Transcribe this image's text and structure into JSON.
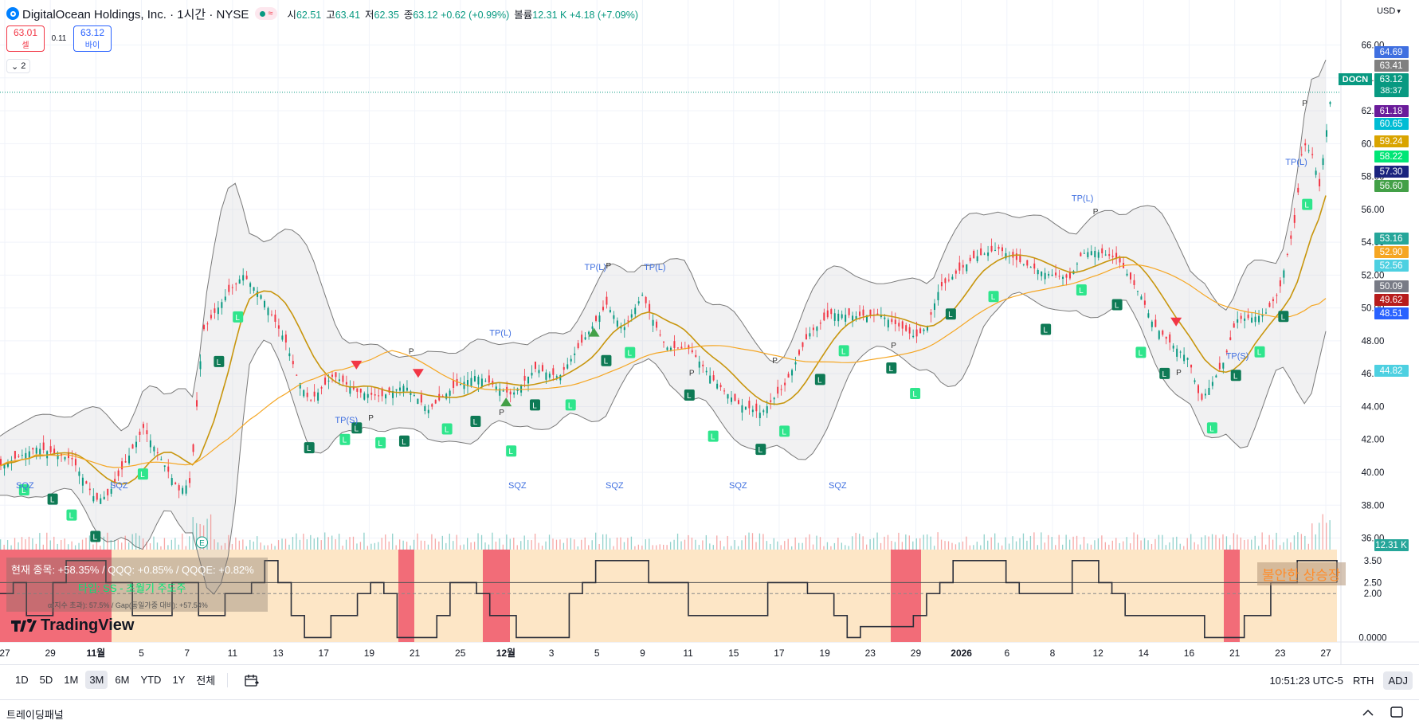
{
  "header": {
    "symbol_title": "DigitalOcean Holdings, Inc. · 1시간 · NYSE",
    "status_icon": "≈",
    "ohlc": [
      {
        "k": "시",
        "v": "62.51"
      },
      {
        "k": "고",
        "v": "63.41"
      },
      {
        "k": "저",
        "v": "62.35"
      },
      {
        "k": "종",
        "v": "63.12 +0.62 (+0.99%)"
      }
    ],
    "volume_label": "볼륨",
    "volume_value": "12.31 K +4.18 (+7.09%)"
  },
  "trade": {
    "sell_price": "63.01",
    "sell_label": "셀",
    "spread": "0.11",
    "buy_price": "63.12",
    "buy_label": "바이"
  },
  "collapse": {
    "icon": "chevron-down-icon",
    "count": "2"
  },
  "currency": {
    "label": "USD"
  },
  "chart_data": {
    "type": "candlestick",
    "symbol": "DOCN",
    "price_axis": {
      "ticks": [
        "66.00",
        "64.00",
        "62.00",
        "60.00",
        "58.00",
        "56.00",
        "54.00",
        "52.00",
        "50.00",
        "48.00",
        "46.00",
        "44.00",
        "42.00",
        "40.00",
        "38.00",
        "36.00"
      ],
      "tick_values": [
        66,
        64,
        62,
        60,
        58,
        56,
        54,
        52,
        50,
        48,
        46,
        44,
        42,
        40,
        38,
        36
      ],
      "range": [
        35.3,
        66.8
      ]
    },
    "time_axis": {
      "labels": [
        "27",
        "29",
        "11월",
        "5",
        "7",
        "11",
        "13",
        "17",
        "19",
        "21",
        "25",
        "12월",
        "3",
        "5",
        "9",
        "11",
        "15",
        "17",
        "19",
        "23",
        "29",
        "2026",
        "6",
        "8",
        "12",
        "14",
        "16",
        "21",
        "23",
        "27"
      ],
      "bold": [
        "11월",
        "12월",
        "2026"
      ]
    },
    "price_path": [
      [
        0,
        40.4
      ],
      [
        15,
        41.5
      ],
      [
        30,
        40.8
      ],
      [
        40,
        38.3
      ],
      [
        45,
        38.6
      ],
      [
        50,
        39.9
      ],
      [
        60,
        42.7
      ],
      [
        75,
        38.9
      ],
      [
        80,
        39.4
      ],
      [
        85,
        48.6
      ],
      [
        95,
        50.8
      ],
      [
        102,
        52.0
      ],
      [
        110,
        50.7
      ],
      [
        120,
        47.9
      ],
      [
        125,
        45.7
      ],
      [
        130,
        44.3
      ],
      [
        140,
        45.9
      ],
      [
        150,
        44.9
      ],
      [
        160,
        44.6
      ],
      [
        170,
        45.3
      ],
      [
        180,
        43.8
      ],
      [
        190,
        45.1
      ],
      [
        200,
        45.9
      ],
      [
        215,
        44.7
      ],
      [
        225,
        46.3
      ],
      [
        235,
        45.8
      ],
      [
        245,
        48.0
      ],
      [
        255,
        50.2
      ],
      [
        262,
        48.7
      ],
      [
        270,
        50.8
      ],
      [
        275,
        49.1
      ],
      [
        280,
        47.6
      ],
      [
        290,
        47.5
      ],
      [
        300,
        45.6
      ],
      [
        310,
        44.2
      ],
      [
        320,
        43.6
      ],
      [
        330,
        45.3
      ],
      [
        340,
        48.4
      ],
      [
        350,
        49.7
      ],
      [
        360,
        49.5
      ],
      [
        370,
        49.6
      ],
      [
        380,
        48.7
      ],
      [
        385,
        48.2
      ],
      [
        390,
        48.9
      ],
      [
        395,
        51.2
      ],
      [
        410,
        53.1
      ],
      [
        420,
        53.6
      ],
      [
        430,
        52.7
      ],
      [
        440,
        52.1
      ],
      [
        450,
        51.8
      ],
      [
        455,
        53.3
      ],
      [
        460,
        53.5
      ],
      [
        470,
        53.0
      ],
      [
        480,
        50.7
      ],
      [
        485,
        49.0
      ],
      [
        492,
        47.9
      ],
      [
        500,
        46.9
      ],
      [
        505,
        44.3
      ],
      [
        510,
        45.5
      ],
      [
        515,
        46.8
      ],
      [
        520,
        49.3
      ],
      [
        526,
        49.4
      ],
      [
        532,
        49.6
      ],
      [
        538,
        51.0
      ],
      [
        545,
        55.5
      ],
      [
        548,
        60.1
      ],
      [
        552,
        59.3
      ],
      [
        555,
        57.4
      ],
      [
        560,
        63.1
      ]
    ],
    "price_x_range": [
      0,
      560
    ],
    "price_labels": [
      {
        "value": "64.69",
        "color": "#3f6fe0"
      },
      {
        "value": "63.41",
        "color": "#808080"
      },
      {
        "value": "63.12",
        "sub": "38:37",
        "color": "#089981",
        "tag": "DOCN"
      },
      {
        "value": "61.18",
        "color": "#6a1b9a"
      },
      {
        "value": "60.65",
        "color": "#00bcd4"
      },
      {
        "value": "59.24",
        "color": "#d9a400"
      },
      {
        "value": "58.22",
        "color": "#00e676"
      },
      {
        "value": "57.30",
        "color": "#1a237e"
      },
      {
        "value": "56.60",
        "color": "#43a047"
      },
      {
        "value": "53.16",
        "color": "#26a69a"
      },
      {
        "value": "52.90",
        "color": "#f5a623"
      },
      {
        "value": "52.56",
        "color": "#4dd0e1"
      },
      {
        "value": "50.09",
        "color": "#787b86"
      },
      {
        "value": "49.62",
        "color": "#b71c1c"
      },
      {
        "value": "48.51",
        "color": "#2962ff"
      },
      {
        "value": "44.82",
        "color": "#4dd0e1"
      },
      {
        "value": "12.31 K",
        "color": "#26a69a"
      }
    ],
    "annotations": {
      "tp_labels": [
        "TP(L)",
        "TP(L)",
        "TP(L)",
        "TP(L)",
        "TP(L)",
        "TP(S)",
        "TP(S)"
      ],
      "sqz_labels": [
        "SQZ",
        "SQZ",
        "SQZ",
        "SQZ",
        "SQZ",
        "SQZ"
      ],
      "p_labels": [
        "P",
        "P",
        "P",
        "P",
        "P",
        "P",
        "P",
        "P",
        "P",
        "P"
      ],
      "earnings_marker": "E"
    },
    "sub_pane": {
      "axis_ticks": [
        "3.50",
        "2.50",
        "2.00",
        "0.0000"
      ],
      "tick_values": [
        3.5,
        2.5,
        2.0,
        0.0
      ],
      "range": [
        -0.2,
        4.0
      ],
      "line_values": [
        2,
        2.5,
        1,
        1,
        2.5,
        3.5,
        3.5,
        3.5,
        2.5,
        2.5,
        1,
        1,
        1,
        2.5,
        2.5,
        1,
        1,
        2,
        2,
        2.5,
        3.5,
        2.5,
        1,
        0,
        0,
        1,
        1,
        2,
        2.5,
        2,
        0,
        0,
        0,
        1,
        2.5,
        2.5,
        2,
        1,
        1,
        0,
        0,
        0,
        0,
        2,
        2.5,
        3.5,
        3.5,
        3.5,
        3.5,
        2.5,
        2.5,
        2.5,
        1,
        1,
        1,
        1,
        1,
        1,
        2.5,
        2.5,
        2.5,
        2,
        2,
        1,
        0,
        0.5,
        0.5,
        0.5,
        0.5,
        1,
        2,
        2.5,
        3.5,
        3.5,
        3.5,
        3.5,
        2.5,
        2,
        2,
        2,
        2,
        3.5,
        3.5,
        2.5,
        2,
        1,
        1,
        1,
        1,
        1,
        1,
        0,
        0,
        0,
        1,
        1,
        2.5,
        2.5,
        3.5,
        3.5,
        3.5,
        2.5
      ],
      "text_line1": "현재 종목: +58.35% / QQQ: +0.85% / QQQE: +0.82%",
      "text_line2": "타입: SS - 초월기 주도주",
      "text_line3": "α(지수 초과): 57.5% / Gap(동일가중 대비): +57.54%",
      "regime_label": "불안한 상승장"
    }
  },
  "branding": {
    "logo_text": "TradingView"
  },
  "bottom_bar": {
    "ranges": [
      "1D",
      "5D",
      "1M",
      "3M",
      "6M",
      "YTD",
      "1Y",
      "전체"
    ],
    "active_range": "3M",
    "time": "10:51:23 UTC-5",
    "session": "RTH",
    "adj": "ADJ"
  },
  "panel": {
    "label": "트레이딩패널"
  }
}
